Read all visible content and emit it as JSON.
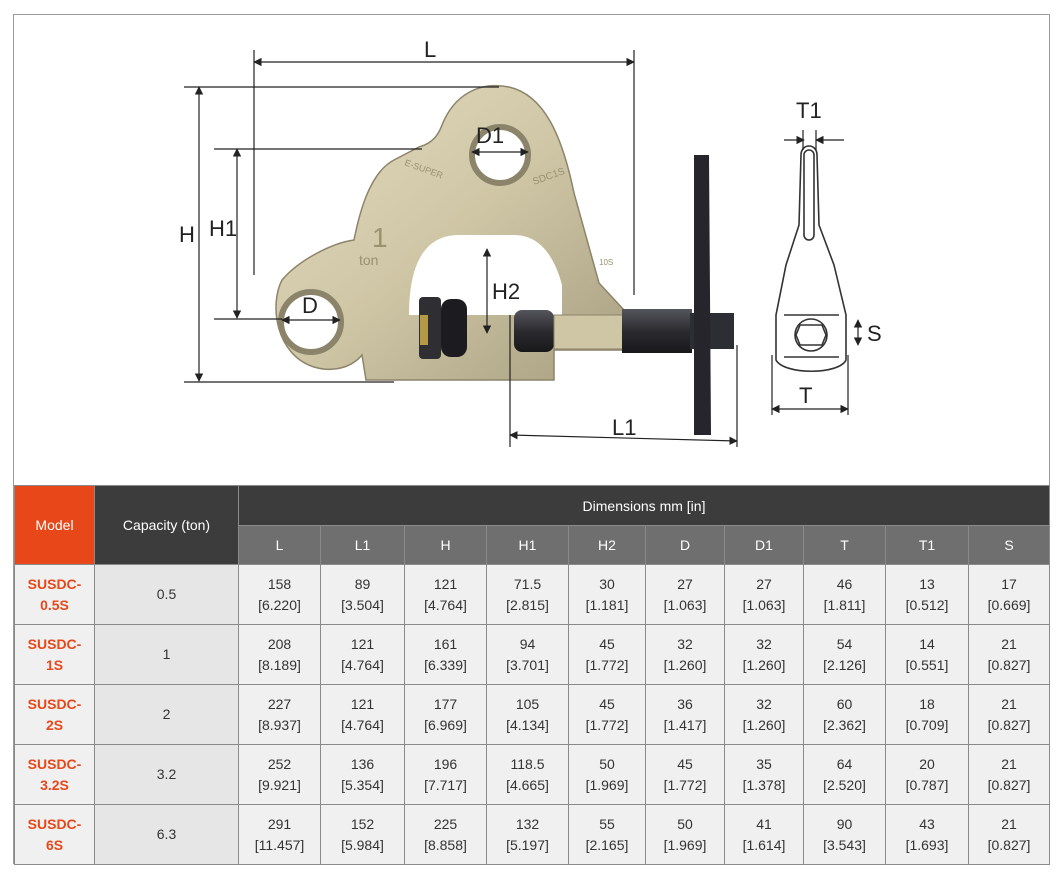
{
  "figure": {
    "labels": {
      "L": "L",
      "H": "H",
      "H1": "H1",
      "H2": "H2",
      "D": "D",
      "D1": "D1",
      "L1": "L1",
      "T": "T",
      "T1": "T1",
      "S": "S",
      "engrave_capacity_num": "1",
      "engrave_capacity_unit": "ton",
      "engrave_model": "SDC1S",
      "engrave_brand": "E-SUPER",
      "engrave_mark": "10S"
    },
    "colors": {
      "clamp_body": "#cfc6a6",
      "clamp_shadow": "#a89f80",
      "screw": "#2b2b30"
    }
  },
  "table": {
    "headers": {
      "model": "Model",
      "capacity": "Capacity (ton)",
      "dimensions": "Dimensions mm [in]",
      "columns": [
        "L",
        "L1",
        "H",
        "H1",
        "H2",
        "D",
        "D1",
        "T",
        "T1",
        "S"
      ]
    },
    "rows": [
      {
        "model_line1": "SUSDC-",
        "model_line2": "0.5S",
        "capacity": "0.5",
        "mm": [
          "158",
          "89",
          "121",
          "71.5",
          "30",
          "27",
          "27",
          "46",
          "13",
          "17"
        ],
        "inch": [
          "[6.220]",
          "[3.504]",
          "[4.764]",
          "[2.815]",
          "[1.181]",
          "[1.063]",
          "[1.063]",
          "[1.811]",
          "[0.512]",
          "[0.669]"
        ]
      },
      {
        "model_line1": "SUSDC-",
        "model_line2": "1S",
        "capacity": "1",
        "mm": [
          "208",
          "121",
          "161",
          "94",
          "45",
          "32",
          "32",
          "54",
          "14",
          "21"
        ],
        "inch": [
          "[8.189]",
          "[4.764]",
          "[6.339]",
          "[3.701]",
          "[1.772]",
          "[1.260]",
          "[1.260]",
          "[2.126]",
          "[0.551]",
          "[0.827]"
        ]
      },
      {
        "model_line1": "SUSDC-",
        "model_line2": "2S",
        "capacity": "2",
        "mm": [
          "227",
          "121",
          "177",
          "105",
          "45",
          "36",
          "32",
          "60",
          "18",
          "21"
        ],
        "inch": [
          "[8.937]",
          "[4.764]",
          "[6.969]",
          "[4.134]",
          "[1.772]",
          "[1.417]",
          "[1.260]",
          "[2.362]",
          "[0.709]",
          "[0.827]"
        ]
      },
      {
        "model_line1": "SUSDC-",
        "model_line2": "3.2S",
        "capacity": "3.2",
        "mm": [
          "252",
          "136",
          "196",
          "118.5",
          "50",
          "45",
          "35",
          "64",
          "20",
          "21"
        ],
        "inch": [
          "[9.921]",
          "[5.354]",
          "[7.717]",
          "[4.665]",
          "[1.969]",
          "[1.772]",
          "[1.378]",
          "[2.520]",
          "[0.787]",
          "[0.827]"
        ]
      },
      {
        "model_line1": "SUSDC-",
        "model_line2": "6S",
        "capacity": "6.3",
        "mm": [
          "291",
          "152",
          "225",
          "132",
          "55",
          "50",
          "41",
          "90",
          "43",
          "21"
        ],
        "inch": [
          "[11.457]",
          "[5.984]",
          "[8.858]",
          "[5.197]",
          "[2.165]",
          "[1.969]",
          "[1.614]",
          "[3.543]",
          "[1.693]",
          "[0.827]"
        ]
      }
    ]
  }
}
